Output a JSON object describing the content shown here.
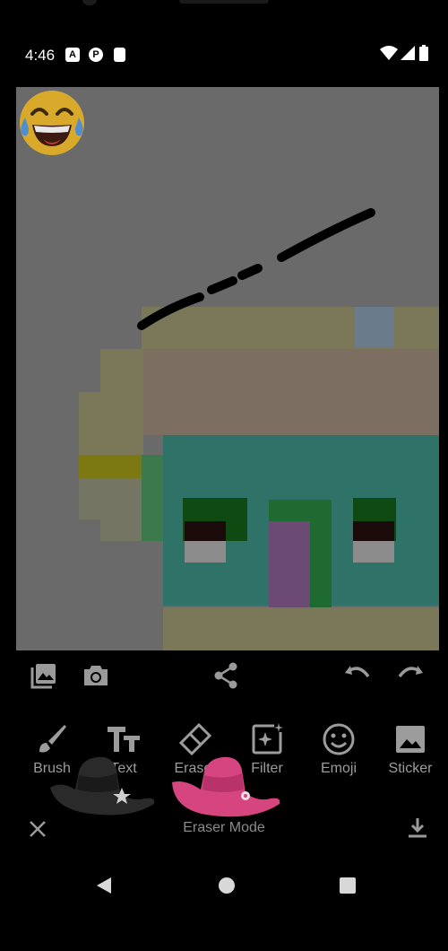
{
  "status_bar": {
    "time": "4:46",
    "left_icons": [
      "a-icon",
      "p-icon",
      "sd-card-icon"
    ],
    "right_icons": [
      "wifi-icon",
      "signal-icon",
      "battery-icon"
    ]
  },
  "canvas": {
    "background": "#6a6a6a",
    "emoji": "face-with-tears-of-joy",
    "drawing": "pixel-art house with black brush stroke"
  },
  "actions": {
    "gallery": "gallery-icon",
    "camera": "camera-icon",
    "share": "share-icon",
    "undo": "undo-icon",
    "redo": "redo-icon"
  },
  "tools": [
    {
      "label": "Brush",
      "icon": "brush-icon"
    },
    {
      "label": "Text",
      "icon": "text-icon"
    },
    {
      "label": "Eraser",
      "icon": "eraser-icon"
    },
    {
      "label": "Filter",
      "icon": "filter-icon"
    },
    {
      "label": "Emoji",
      "icon": "emoji-icon"
    },
    {
      "label": "Sticker",
      "icon": "sticker-icon"
    }
  ],
  "bottom_bar": {
    "mode_label": "Eraser Mode",
    "close_icon": "close-icon",
    "save_icon": "download-icon"
  },
  "nav": {
    "back": "back-icon",
    "home": "home-icon",
    "recents": "recents-icon"
  },
  "colors": {
    "background": "#000000",
    "canvas": "#6a6a6a",
    "label": "#9c9c9c",
    "black_hat": "#2a2a2a",
    "pink_hat": "#d6457f"
  }
}
